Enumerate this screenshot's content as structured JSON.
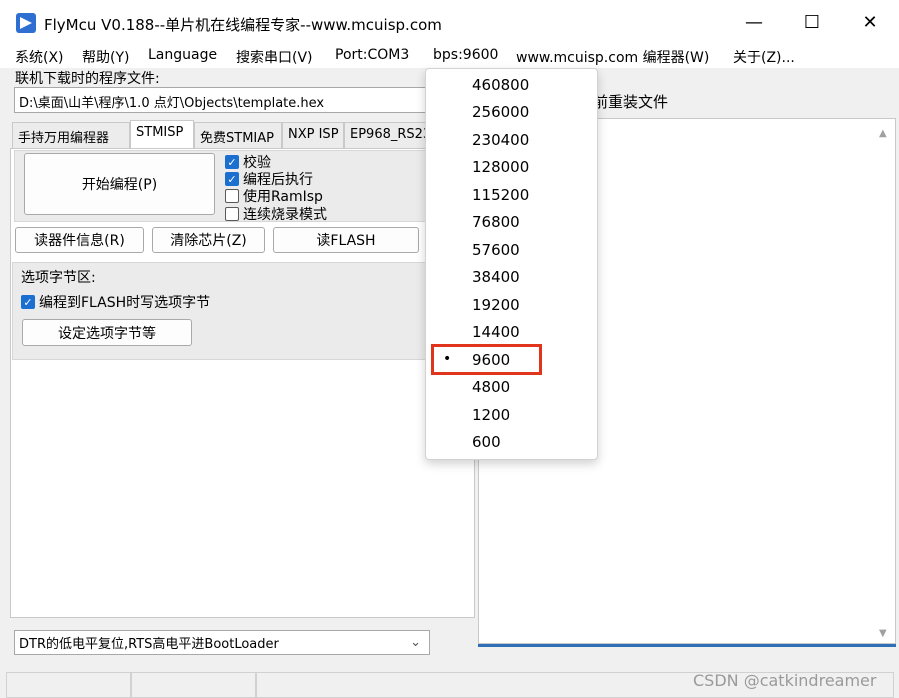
{
  "window": {
    "title": "FlyMcu V0.188--单片机在线编程专家--www.mcuisp.com",
    "minimize": "—",
    "maximize": "☐",
    "close": "✕"
  },
  "menu": [
    "系统(X)",
    "帮助(Y)",
    "Language",
    "搜索串口(V)",
    "Port:COM3",
    "bps:9600",
    "www.mcuisp.com 编程器(W)",
    "关于(Z)..."
  ],
  "file": {
    "label": "联机下载时的程序文件:",
    "path": "D:\\桌面\\山羊\\程序\\1.0 点灯\\Objects\\template.hex",
    "reload_suffix": "前重装文件"
  },
  "tabs": [
    "手持万用编程器",
    "STMISP",
    "免费STMIAP",
    "NXP ISP",
    "EP968_RS23"
  ],
  "stmisp": {
    "start_button": "开始编程(P)",
    "checkboxes": [
      {
        "label": "校验",
        "checked": true
      },
      {
        "label": "编程后执行",
        "checked": true
      },
      {
        "label": "使用RamIsp",
        "checked": false
      },
      {
        "label": "连续烧录模式",
        "checked": false
      }
    ],
    "read_info_button": "读器件信息(R)",
    "erase_button": "清除芯片(Z)",
    "read_flash_button": "读FLASH",
    "option_group_label": "选项字节区:",
    "option_checkbox": {
      "label": "编程到FLASH时写选项字节",
      "checked": true
    },
    "option_button": "设定选项字节等"
  },
  "reset_select": {
    "value": "DTR的低电平复位,RTS高电平进BootLoader",
    "arrow": "⌄"
  },
  "bps_dropdown": {
    "options": [
      "460800",
      "256000",
      "230400",
      "128000",
      "115200",
      "76800",
      "57600",
      "38400",
      "19200",
      "14400",
      "9600",
      "4800",
      "1200",
      "600"
    ],
    "selected": "9600",
    "bullet": "•",
    "highlight_color": "#e0341c"
  },
  "scroll": {
    "up": "▲",
    "down": "▼"
  },
  "watermark": "CSDN @catkindreamer"
}
